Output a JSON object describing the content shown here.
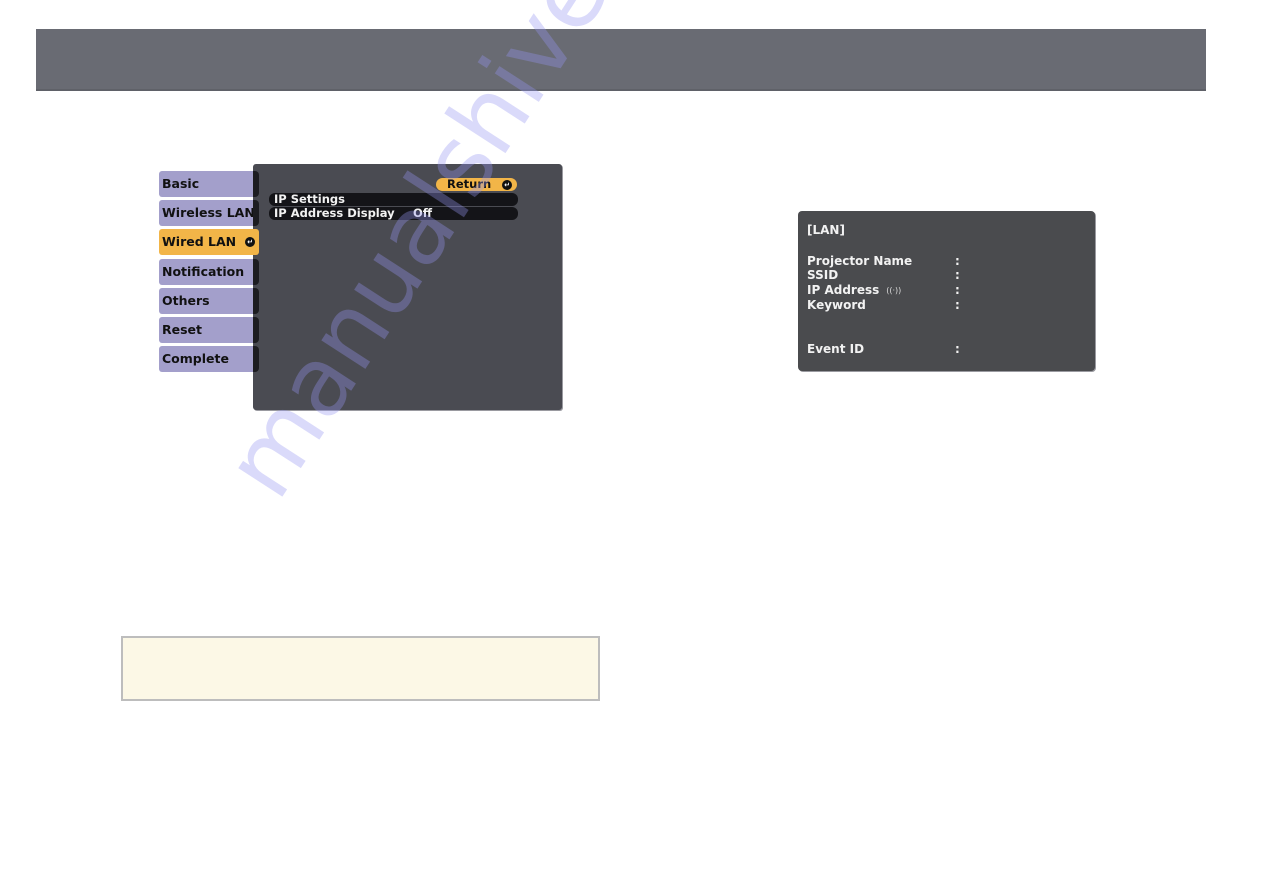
{
  "header": {
    "title": ""
  },
  "menu_screen": {
    "tabs": [
      {
        "label": "Basic",
        "active": false
      },
      {
        "label": "Wireless LAN",
        "active": false
      },
      {
        "label": "Wired LAN",
        "active": true
      },
      {
        "label": "Notification",
        "active": false
      },
      {
        "label": "Others",
        "active": false
      },
      {
        "label": "Reset",
        "active": false
      },
      {
        "label": "Complete",
        "active": false
      }
    ],
    "return_label": "Return",
    "enter_icon_glyph": "↵",
    "rows": [
      {
        "label": "IP Settings",
        "value": ""
      },
      {
        "label": "IP Address Display",
        "value": "Off"
      }
    ],
    "colors": {
      "active_tab": "#f2b548",
      "inactive_tab": "#a39fcb",
      "panel": "#4a4b52"
    }
  },
  "lan_screen": {
    "title": "[LAN]",
    "fields": [
      {
        "label": "Projector Name",
        "colon": ":"
      },
      {
        "label": "SSID",
        "colon": ":"
      },
      {
        "label": "IP Address",
        "colon": ":",
        "icon": "((·))"
      },
      {
        "label": "Keyword",
        "colon": ":"
      },
      {
        "label": "Event ID",
        "colon": ":"
      }
    ]
  },
  "note_box": {
    "text": ""
  },
  "watermark": "manualshive.com"
}
